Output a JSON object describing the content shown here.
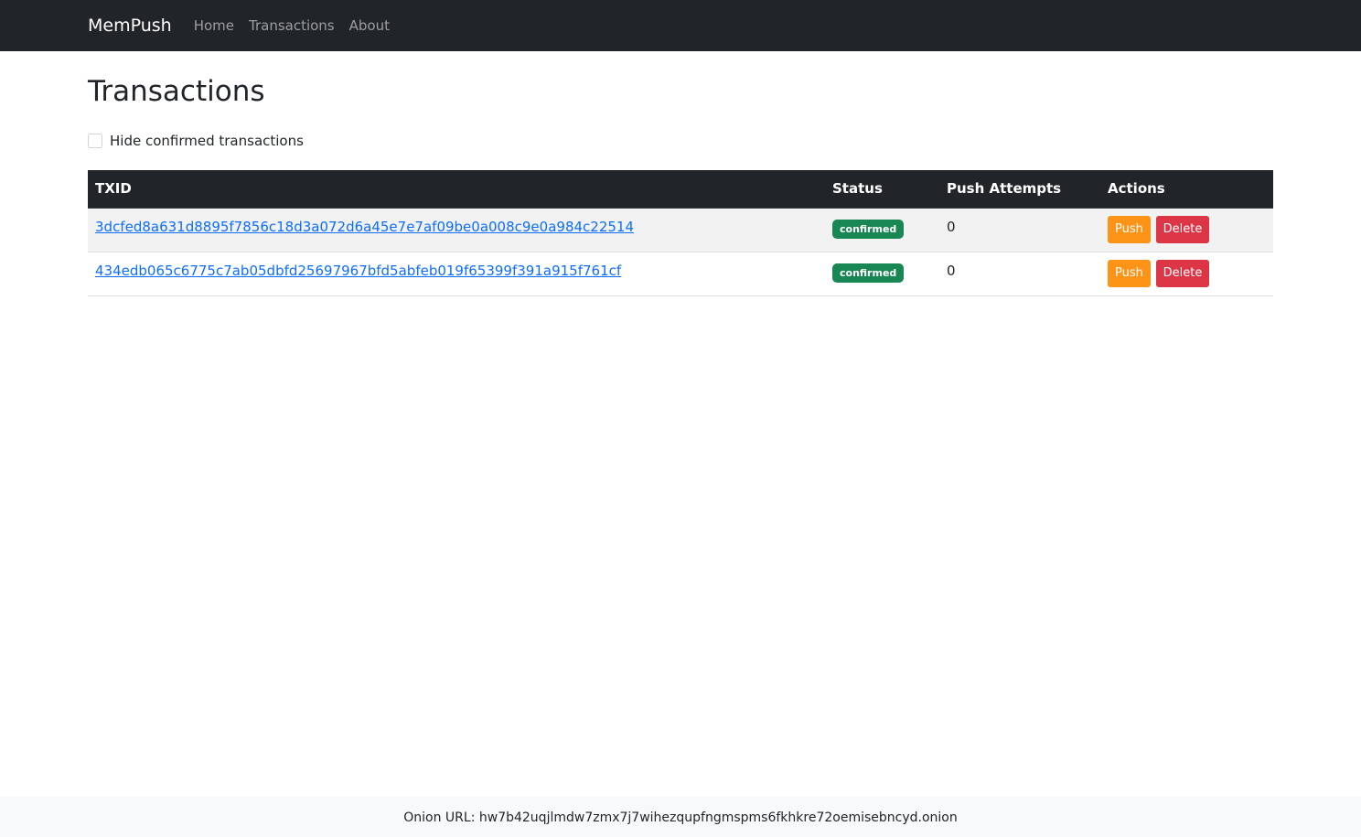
{
  "navbar": {
    "brand": "MemPush",
    "links": [
      {
        "label": "Home"
      },
      {
        "label": "Transactions"
      },
      {
        "label": "About"
      }
    ]
  },
  "main": {
    "title": "Transactions",
    "filter_label": "Hide confirmed transactions",
    "filter_checked": false
  },
  "table": {
    "headers": {
      "txid": "TXID",
      "status": "Status",
      "attempts": "Push Attempts",
      "actions": "Actions"
    },
    "rows": [
      {
        "txid": "3dcfed8a631d8895f7856c18d3a072d6a45e7e7af09be0a008c9e0a984c22514",
        "status": "confirmed",
        "attempts": "0",
        "push_label": "Push",
        "delete_label": "Delete"
      },
      {
        "txid": "434edb065c6775c7ab05dbfd25697967bfd5abfeb019f65399f391a915f761cf",
        "status": "confirmed",
        "attempts": "0",
        "push_label": "Push",
        "delete_label": "Delete"
      }
    ]
  },
  "footer": {
    "text": "Onion URL: hw7b42uqjlmdw7zmx7j7wihezqupfngmspms6fkhkre72oemisebncyd.onion"
  },
  "colors": {
    "navbar_bg": "#212529",
    "link": "#0d6efd",
    "badge_confirmed": "#198754",
    "push_button": "#fd9317",
    "delete_button": "#dc3545"
  }
}
